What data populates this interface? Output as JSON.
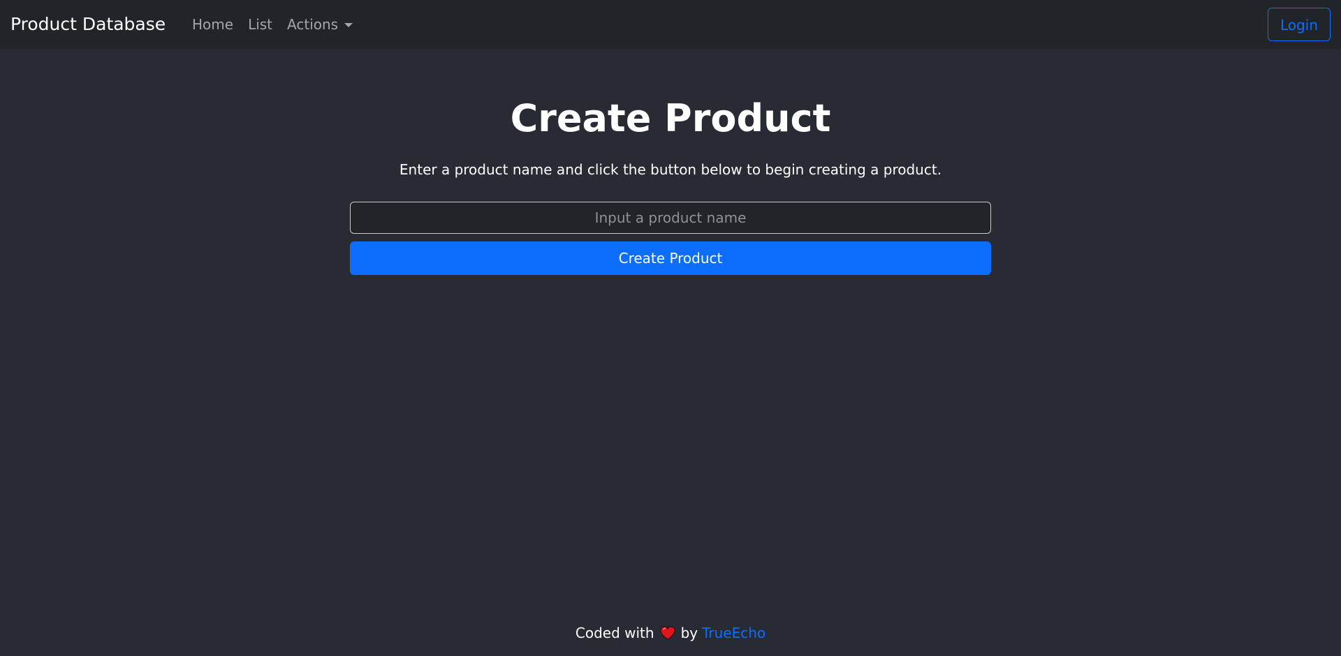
{
  "navbar": {
    "brand": "Product Database",
    "links": [
      {
        "label": "Home"
      },
      {
        "label": "List"
      },
      {
        "label": "Actions"
      }
    ],
    "login_label": "Login"
  },
  "main": {
    "title": "Create Product",
    "lead": "Enter a product name and click the button below to begin creating a product.",
    "input": {
      "placeholder": "Input a product name",
      "value": ""
    },
    "create_button_label": "Create Product"
  },
  "footer": {
    "prefix": "Coded with",
    "heart_icon": "heart-icon",
    "by": "by",
    "author": "TrueEcho"
  },
  "colors": {
    "accent": "#0d6efd",
    "navbar_bg": "#212529",
    "page_bg": "#282b34",
    "heart": "#e0161e"
  }
}
